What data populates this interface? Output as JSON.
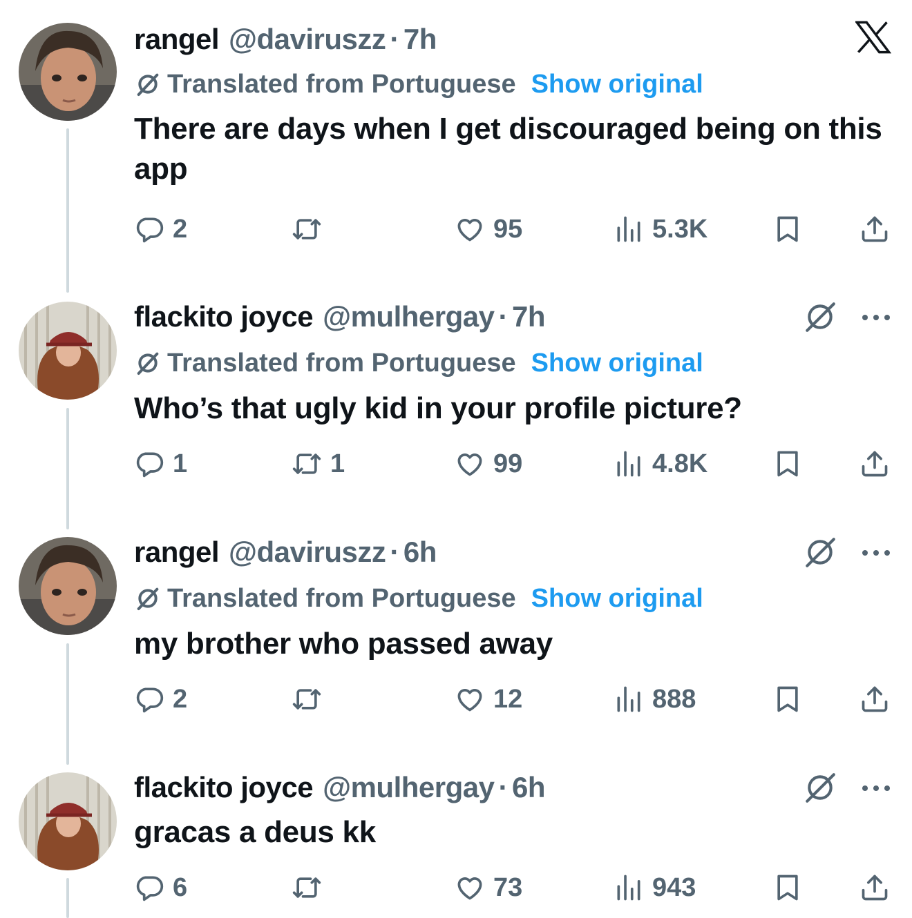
{
  "translation": {
    "label": "Translated from Portuguese",
    "show_original": "Show original"
  },
  "colors": {
    "text": "#0f1419",
    "secondary": "#536471",
    "link": "#1d9bf0",
    "thread_line": "#cfd9de"
  },
  "tweets": [
    {
      "name": "rangel",
      "handle": "@daviruszz",
      "time": "7h",
      "translated": true,
      "text": "There are days when I get discouraged being on this app",
      "replies": "2",
      "reposts": "",
      "likes": "95",
      "views": "5.3K"
    },
    {
      "name": "flackito joyce",
      "handle": "@mulhergay",
      "time": "7h",
      "translated": true,
      "text": "Who’s that ugly kid in your profile picture?",
      "replies": "1",
      "reposts": "1",
      "likes": "99",
      "views": "4.8K"
    },
    {
      "name": "rangel",
      "handle": "@daviruszz",
      "time": "6h",
      "translated": true,
      "text": "my brother who passed away",
      "replies": "2",
      "reposts": "",
      "likes": "12",
      "views": "888"
    },
    {
      "name": "flackito joyce",
      "handle": "@mulhergay",
      "time": "6h",
      "translated": false,
      "text": "gracas a deus kk",
      "replies": "6",
      "reposts": "",
      "likes": "73",
      "views": "943"
    }
  ],
  "separator": "·"
}
